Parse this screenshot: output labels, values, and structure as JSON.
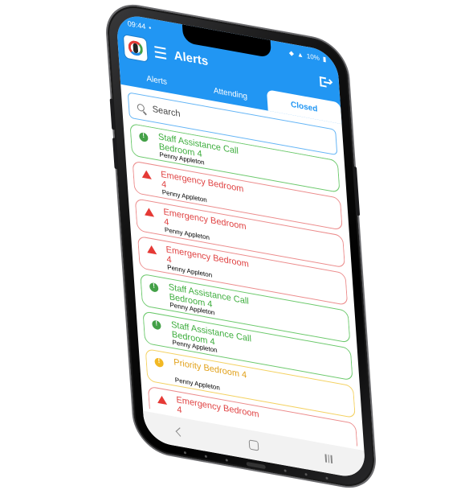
{
  "status": {
    "time": "09:44",
    "battery": "10%"
  },
  "header": {
    "title": "Alerts"
  },
  "tabs": [
    {
      "label": "Alerts"
    },
    {
      "label": "Attending"
    },
    {
      "label": "Closed"
    }
  ],
  "search": {
    "placeholder": "Search"
  },
  "alerts": [
    {
      "kind": "assistance",
      "line1": "Staff Assistance Call",
      "line2": "Bedroom 4",
      "person": "Penny Appleton"
    },
    {
      "kind": "emergency",
      "line1": "Emergency Bedroom",
      "line2": "4",
      "person": "Penny Appleton"
    },
    {
      "kind": "emergency",
      "line1": "Emergency Bedroom",
      "line2": "4",
      "person": "Penny Appleton"
    },
    {
      "kind": "emergency",
      "line1": "Emergency Bedroom",
      "line2": "4",
      "person": "Penny Appleton"
    },
    {
      "kind": "assistance",
      "line1": "Staff Assistance Call",
      "line2": "Bedroom 4",
      "person": "Penny Appleton"
    },
    {
      "kind": "assistance",
      "line1": "Staff Assistance Call",
      "line2": "Bedroom 4",
      "person": "Penny Appleton"
    },
    {
      "kind": "priority",
      "line1": "Priority Bedroom 4",
      "line2": "",
      "person": "Penny Appleton"
    },
    {
      "kind": "emergency",
      "line1": "Emergency Bedroom",
      "line2": "4",
      "person": "Penny Appleton"
    }
  ],
  "colors": {
    "appbar": "#2196f3",
    "assistance": "#43a047",
    "emergency": "#e53935",
    "priority": "#f2b823"
  }
}
